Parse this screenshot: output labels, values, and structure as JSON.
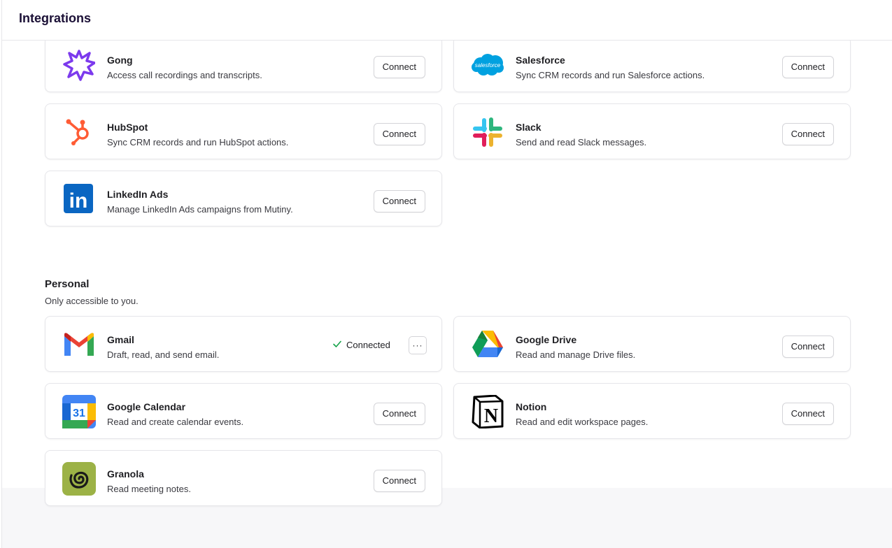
{
  "header": {
    "title": "Integrations"
  },
  "workspace": {
    "items": [
      {
        "name": "Gong",
        "description": "Access call recordings and transcripts.",
        "action": "Connect",
        "icon": "gong-icon"
      },
      {
        "name": "Salesforce",
        "description": "Sync CRM records and run Salesforce actions.",
        "action": "Connect",
        "icon": "salesforce-icon",
        "logo_text": "salesforce"
      },
      {
        "name": "HubSpot",
        "description": "Sync CRM records and run HubSpot actions.",
        "action": "Connect",
        "icon": "hubspot-icon"
      },
      {
        "name": "Slack",
        "description": "Send and read Slack messages.",
        "action": "Connect",
        "icon": "slack-icon"
      },
      {
        "name": "LinkedIn Ads",
        "description": "Manage LinkedIn Ads campaigns from Mutiny.",
        "action": "Connect",
        "icon": "linkedin-icon",
        "logo_text": "in"
      }
    ]
  },
  "personal": {
    "title": "Personal",
    "subtitle": "Only accessible to you.",
    "items": [
      {
        "name": "Gmail",
        "description": "Draft, read, and send email.",
        "status": "Connected",
        "more_label": "···",
        "icon": "gmail-icon"
      },
      {
        "name": "Google Drive",
        "description": "Read and manage Drive files.",
        "action": "Connect",
        "icon": "google-drive-icon"
      },
      {
        "name": "Google Calendar",
        "description": "Read and create calendar events.",
        "action": "Connect",
        "icon": "google-calendar-icon",
        "logo_text": "31"
      },
      {
        "name": "Notion",
        "description": "Read and edit workspace pages.",
        "action": "Connect",
        "icon": "notion-icon",
        "logo_text": "N"
      },
      {
        "name": "Granola",
        "description": "Read meeting notes.",
        "action": "Connect",
        "icon": "granola-icon"
      }
    ]
  },
  "colors": {
    "title": "#1b1036",
    "gong": "#7c3aed",
    "salesforce": "#00a1e0",
    "hubspot": "#ff5c35",
    "linkedin": "#0a66c2",
    "granola": "#9cb246",
    "connected_check": "#16a34a"
  }
}
